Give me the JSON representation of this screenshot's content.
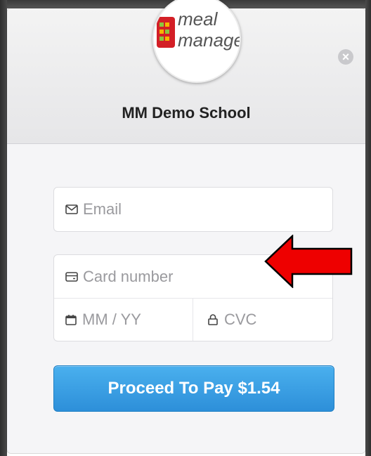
{
  "logo": {
    "line1": "meal",
    "line2": "manage",
    "accent_color": "#d31f26"
  },
  "header": {
    "school_name": "MM Demo School",
    "close_icon": "close-icon"
  },
  "form": {
    "email_placeholder": "Email",
    "card_number_placeholder": "Card number",
    "expiry_placeholder": "MM / YY",
    "cvc_placeholder": "CVC"
  },
  "pay_button": {
    "label": "Proceed To Pay $1.54",
    "color": "#3a9fe4"
  },
  "annotation": {
    "arrow_color": "#ee0000",
    "direction": "left"
  }
}
